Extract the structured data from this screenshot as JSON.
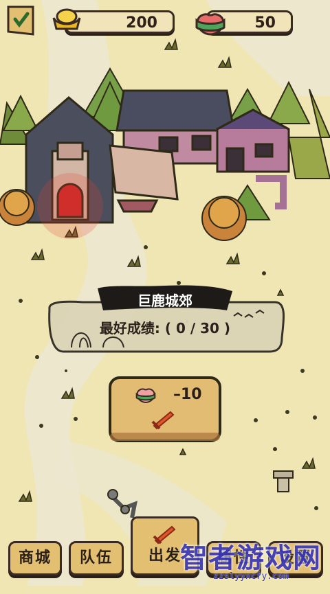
{
  "hud": {
    "gold_amount": "200",
    "peach_amount": "50"
  },
  "stage": {
    "name": "巨鹿城郊",
    "best_label": "最好成绩: ( 0 / 30 )"
  },
  "start": {
    "cost": "–10"
  },
  "tabs": [
    {
      "label": "商城"
    },
    {
      "label": "队伍"
    },
    {
      "label": "出发"
    },
    {
      "label": "属性"
    },
    {
      "label": "设置"
    }
  ],
  "watermark": {
    "text": "智者游戏网",
    "url": "zzslyyxcfy.com"
  },
  "colors": {
    "ground": "#efe6b4",
    "path": "#e9e2c8",
    "button": "#e3bf72",
    "outline": "#3a2b22",
    "red_light": "#d63a2f"
  }
}
